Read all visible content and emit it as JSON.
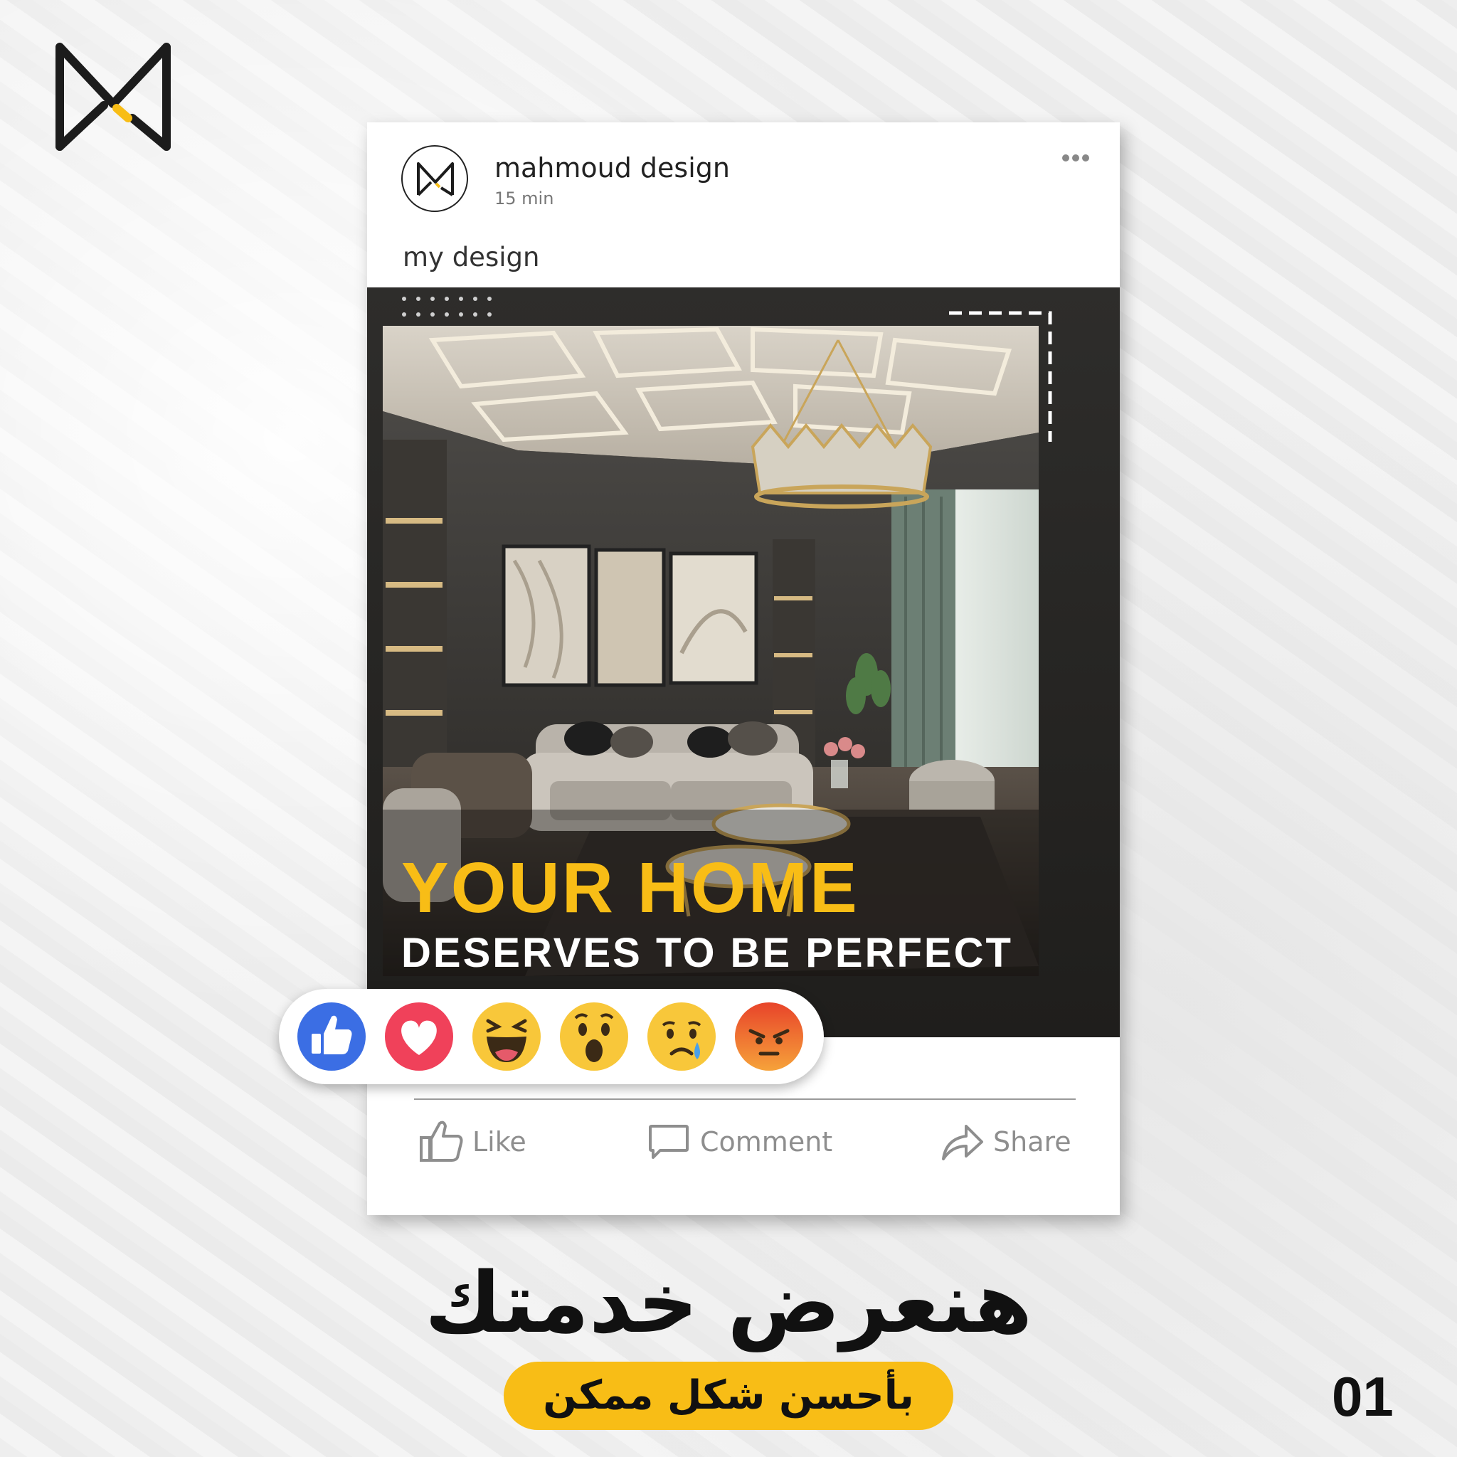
{
  "post": {
    "author": "mahmoud design",
    "time": "15 min",
    "caption": "my design"
  },
  "image": {
    "headline_main": "YOUR HOME",
    "headline_sub": "DESERVES TO BE PERFECT"
  },
  "reactions": [
    {
      "name": "like",
      "icon": "thumbs-up-icon"
    },
    {
      "name": "love",
      "icon": "heart-icon"
    },
    {
      "name": "haha",
      "icon": "laughing-face-icon"
    },
    {
      "name": "wow",
      "icon": "surprised-face-icon"
    },
    {
      "name": "sad",
      "icon": "sad-face-icon"
    },
    {
      "name": "angry",
      "icon": "angry-face-icon"
    }
  ],
  "actions": {
    "like_label": "Like",
    "comment_label": "Comment",
    "share_label": "Share"
  },
  "promo": {
    "title": "هنعرض خدمتك",
    "subtitle": "بأحسن شكل ممكن",
    "page_number": "01"
  },
  "colors": {
    "accent": "#f8bd16",
    "like_blue": "#3b6ee4",
    "love_red": "#f0415a",
    "angry_red": "#e8442a",
    "dark_bg": "#2a2927"
  }
}
